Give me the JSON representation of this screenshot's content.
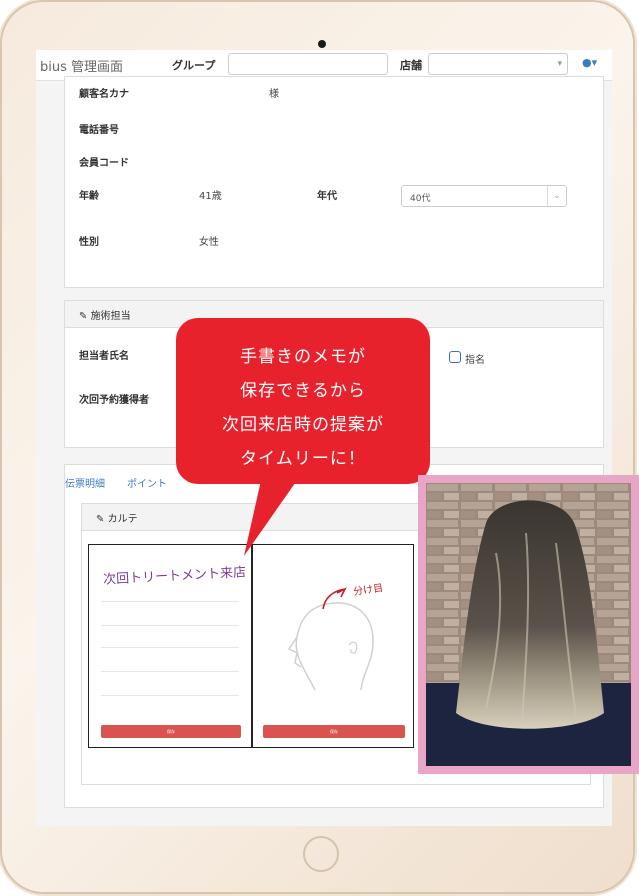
{
  "nav": {
    "brand": "bius 管理画面",
    "group_label": "グループ",
    "store_label": "店舗",
    "user_icon": "user-icon"
  },
  "customer": {
    "kana_label": "顧客名カナ",
    "kana_suffix": "様",
    "phone_label": "電話番号",
    "member_code_label": "会員コード",
    "age_label": "年齢",
    "age_value": "41歳",
    "age_group_label": "年代",
    "age_group_value": "40代",
    "gender_label": "性別",
    "gender_value": "女性"
  },
  "treatment": {
    "header": "施術担当",
    "staff_name_label": "担当者氏名",
    "nominated_label": "指名",
    "next_reservation_label": "次回予約獲得者"
  },
  "tabs": [
    "伝票明細",
    "ポイント"
  ],
  "karte": {
    "header": "カルテ",
    "memo_handwriting": "次回トリートメント来店",
    "sketch_annotation": "分け目",
    "save_button_label": "保存"
  },
  "callout": {
    "lines": [
      "手書きのメモが",
      "保存できるから",
      "次回来店時の提案が",
      "タイムリーに！"
    ]
  },
  "colors": {
    "callout": "#e8222d",
    "save_button": "#d9534f",
    "photo_border": "#e9a5c6",
    "link": "#3c7bbf"
  }
}
